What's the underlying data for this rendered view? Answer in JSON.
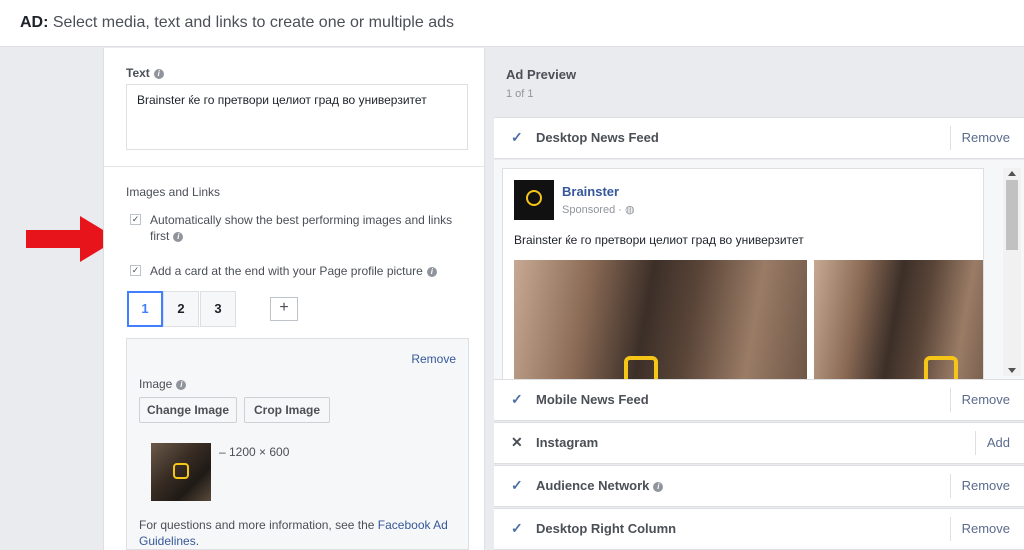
{
  "header": {
    "title_prefix": "AD:",
    "title_text": " Select media, text and links to create one or multiple ads"
  },
  "text_section": {
    "label": "Text",
    "value": "Brainster ќе го претвори целиот град во универзитет"
  },
  "images_links": {
    "label": "Images and Links",
    "checkbox1_line1": "Automatically show the best performing images and links",
    "checkbox1_line2": "first",
    "checkbox2": "Add a card at the end with your Page profile picture",
    "tabs": [
      "1",
      "2",
      "3"
    ],
    "add_tab": "+",
    "remove": "Remove",
    "image_label": "Image",
    "change_image": "Change Image",
    "crop_image": "Crop Image",
    "image_size": "– 1200 × 600",
    "help_prefix": "For questions and more information, see the ",
    "help_link1": "Facebook Ad",
    "help_link2": "Guidelines",
    "help_suffix": "."
  },
  "preview": {
    "title": "Ad Preview",
    "count": "1 of 1",
    "placements": [
      {
        "name": "Desktop News Feed",
        "icon": "✓",
        "action": "Remove"
      },
      {
        "name": "Mobile News Feed",
        "icon": "✓",
        "action": "Remove"
      },
      {
        "name": "Instagram",
        "icon": "✕",
        "action": "Add"
      },
      {
        "name": "Audience Network",
        "icon": "✓",
        "action": "Remove"
      },
      {
        "name": "Desktop Right Column",
        "icon": "✓",
        "action": "Remove"
      }
    ],
    "post": {
      "page_name": "Brainster",
      "sponsored": "Sponsored ·",
      "text": "Brainster ќе го претвори целиот град во универзитет"
    }
  },
  "colors": {
    "accent": "#4080ff",
    "link": "#365899",
    "arrow": "#e8141c"
  }
}
